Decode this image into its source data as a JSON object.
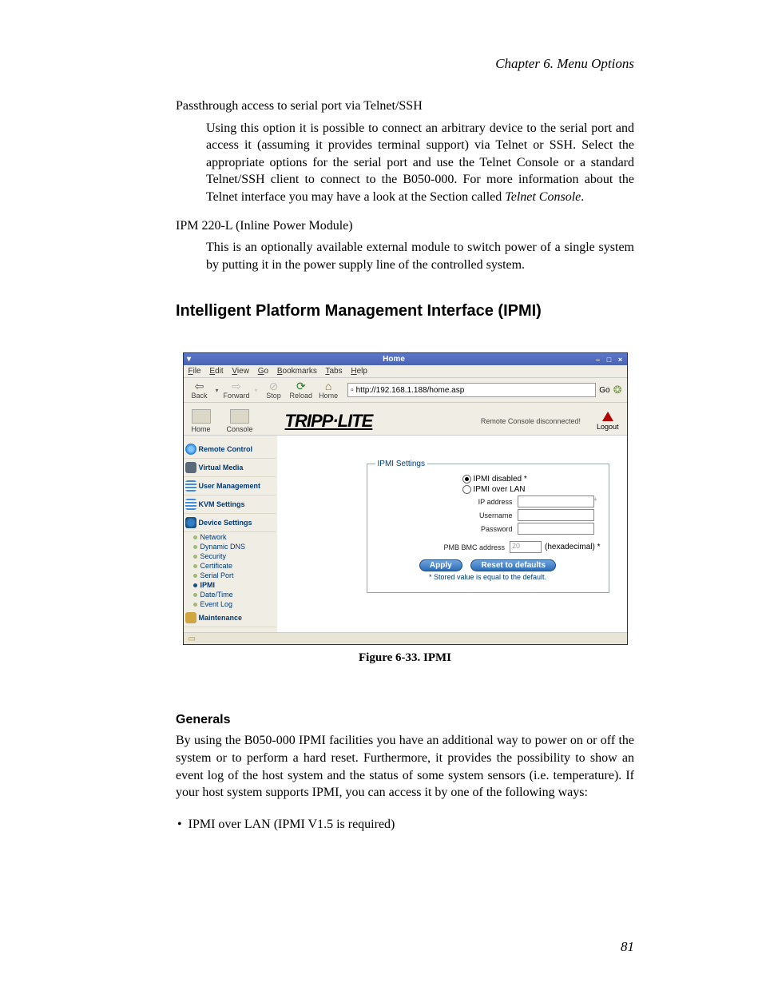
{
  "chapter_header": "Chapter 6. Menu Options",
  "para1": "Passthrough access to serial port via Telnet/SSH",
  "para2a": "Using this option it is possible to connect an arbitrary device to the serial port and access it (assuming it provides terminal support) via Telnet or SSH. Select the appropriate options for the serial port and use the Telnet Console or a standard Telnet/SSH client to connect to the B050-000. For more information about the Telnet interface you may have a look at the Section called ",
  "para2b_italic": "Telnet Console",
  "para2c": ".",
  "para3": "IPM 220-L (Inline Power Module)",
  "para4": "This is an optionally available external module to switch power of a single system by putting it in the power supply line of the controlled system.",
  "section_title": "Intelligent Platform Management Interface (IPMI)",
  "figure_caption": "Figure 6-33. IPMI",
  "subsection_title": "Generals",
  "para5": "By using the B050-000 IPMI facilities you have an additional way to power on or off the system or to perform a hard reset. Furthermore, it provides the possibility to show an event log of the host system and the status of some system sensors (i.e. temperature). If your host system supports IPMI, you can access it by one of the following ways:",
  "bullet1": "IPMI over LAN (IPMI V1.5 is required)",
  "page_number": "81",
  "browser": {
    "title": "Home",
    "menus": {
      "file": "File",
      "edit": "Edit",
      "view": "View",
      "go": "Go",
      "bookmarks": "Bookmarks",
      "tabs": "Tabs",
      "help": "Help"
    },
    "nav": {
      "back": "Back",
      "forward": "Forward",
      "stop": "Stop",
      "reload": "Reload",
      "home": "Home",
      "go": "Go"
    },
    "url": "http://192.168.1.188/home.asp",
    "app": {
      "home": "Home",
      "console": "Console",
      "brand": "TRIPP·LITE",
      "status": "Remote Console disconnected!",
      "logout": "Logout"
    },
    "sidebar": {
      "remote_control": "Remote Control",
      "virtual_media": "Virtual Media",
      "user_management": "User Management",
      "kvm_settings": "KVM Settings",
      "device_settings": "Device Settings",
      "subs": {
        "network": "Network",
        "ddns": "Dynamic DNS",
        "security": "Security",
        "certificate": "Certificate",
        "serial": "Serial Port",
        "ipmi": "IPMI",
        "datetime": "Date/Time",
        "eventlog": "Event Log"
      },
      "maintenance": "Maintenance"
    },
    "ipmi": {
      "legend": "IPMI Settings",
      "opt_disabled": "IPMI disabled *",
      "opt_lan": "IPMI over LAN",
      "ip": "IP address",
      "user": "Username",
      "pass": "Password",
      "bmc": "PMB BMC address",
      "bmc_val": "20",
      "hex": "(hexadecimal) *",
      "apply": "Apply",
      "reset": "Reset to defaults",
      "footnote": "* Stored value is equal to the default."
    }
  }
}
